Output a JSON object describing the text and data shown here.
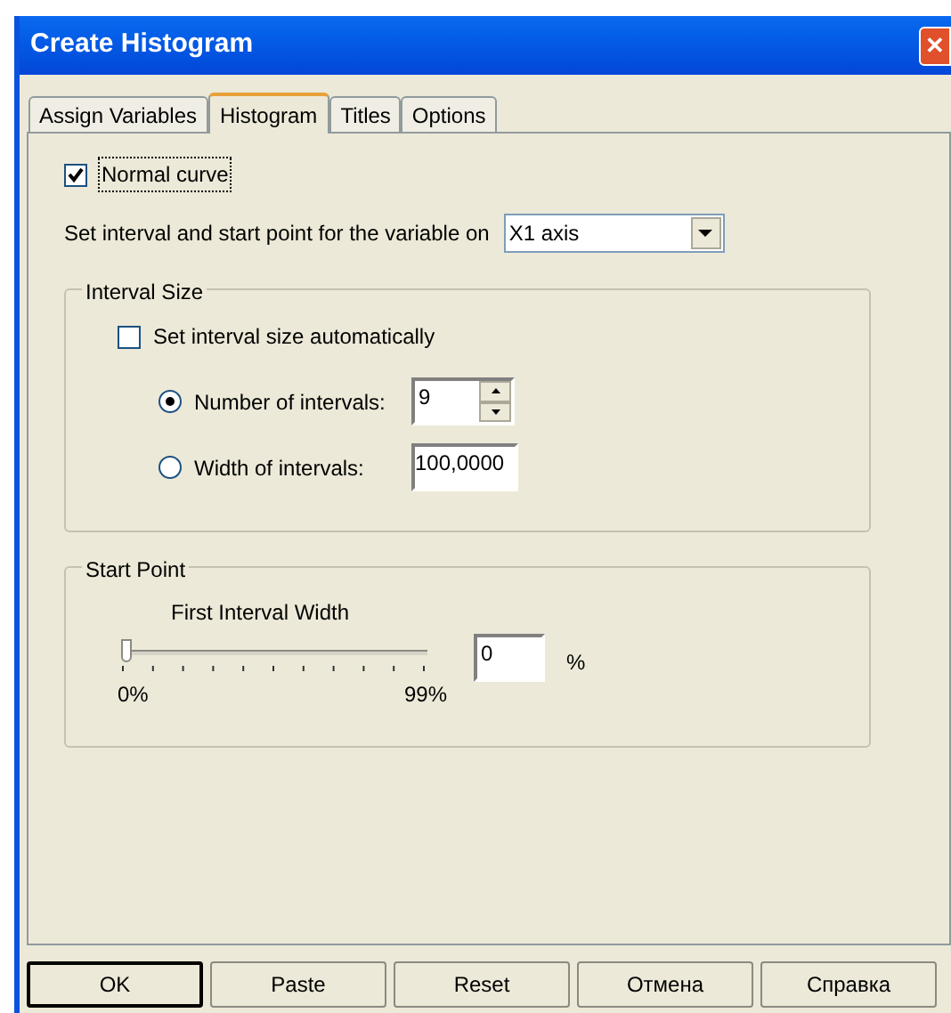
{
  "window": {
    "title": "Create Histogram",
    "close": "✕"
  },
  "tabs": [
    {
      "label": "Assign Variables",
      "selected": false
    },
    {
      "label": "Histogram",
      "selected": true
    },
    {
      "label": "Titles",
      "selected": false
    },
    {
      "label": "Options",
      "selected": false
    }
  ],
  "normal_curve": {
    "label": "Normal curve",
    "checked": true
  },
  "variable_row": {
    "label": "Set interval and start point for the variable on",
    "value": "X1 axis"
  },
  "interval_size": {
    "title": "Interval Size",
    "auto": {
      "label": "Set interval size automatically",
      "checked": false
    },
    "options": [
      {
        "label": "Number of intervals:",
        "selected": true,
        "value": "9",
        "kind": "spinner"
      },
      {
        "label": "Width of intervals:",
        "selected": false,
        "value": "100,0000",
        "kind": "text"
      }
    ]
  },
  "start_point": {
    "title": "Start Point",
    "slider_label": "First Interval Width",
    "level": 0,
    "min_label": "0%",
    "max_label": "99%",
    "value": "0",
    "unit": "%"
  },
  "buttons": [
    {
      "label": "OK",
      "default": true
    },
    {
      "label": "Paste",
      "default": false
    },
    {
      "label": "Reset",
      "default": false
    },
    {
      "label": "Отмена",
      "default": false
    },
    {
      "label": "Справка",
      "default": false
    }
  ]
}
